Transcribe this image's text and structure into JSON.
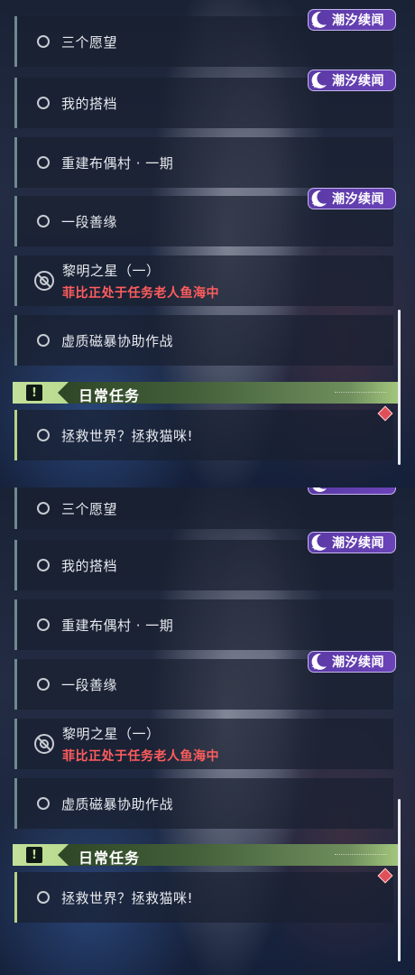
{
  "badge_label": "潮汐续闻",
  "section_header": {
    "title": "日常任务",
    "icon": "exclamation-icon"
  },
  "panels": [
    {
      "quests": [
        {
          "title": "三个愿望",
          "icon": "circle-outline-icon"
        },
        {
          "title": "我的搭档",
          "icon": "circle-outline-icon"
        },
        {
          "title": "重建布偶村 · 一期",
          "icon": "circle-outline-icon"
        },
        {
          "title": "一段善缘",
          "icon": "circle-outline-icon"
        },
        {
          "title": "黎明之星（一）",
          "warning": "菲比正处于任务老人鱼海中",
          "icon": "blocked-icon"
        },
        {
          "title": "虚质磁暴协助作战",
          "icon": "circle-outline-icon"
        }
      ],
      "daily_quests": [
        {
          "title": "拯救世界？拯救猫咪!",
          "icon": "circle-outline-icon"
        }
      ]
    },
    {
      "quests": [
        {
          "title": "三个愿望",
          "icon": "circle-outline-icon"
        },
        {
          "title": "我的搭档",
          "icon": "circle-outline-icon"
        },
        {
          "title": "重建布偶村 · 一期",
          "icon": "circle-outline-icon"
        },
        {
          "title": "一段善缘",
          "icon": "circle-outline-icon"
        },
        {
          "title": "黎明之星（一）",
          "warning": "菲比正处于任务老人鱼海中",
          "icon": "blocked-icon"
        },
        {
          "title": "虚质磁暴协助作战",
          "icon": "circle-outline-icon"
        }
      ],
      "daily_quests": [
        {
          "title": "拯救世界？拯救猫咪!",
          "icon": "circle-outline-icon"
        }
      ]
    }
  ],
  "colors": {
    "badge": "#5a3aa6",
    "section_header": "#b4d98a",
    "warning_text": "#ff5d5d",
    "tracked_marker": "#e0505a"
  }
}
